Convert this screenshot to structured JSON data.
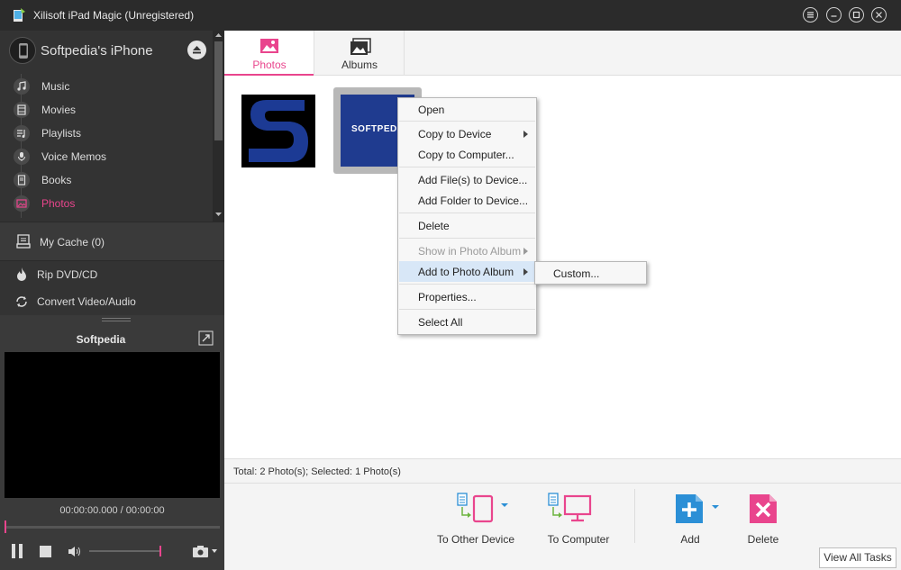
{
  "window": {
    "title": "Xilisoft iPad Magic (Unregistered)"
  },
  "device": {
    "name": "Softpedia's iPhone"
  },
  "nav": {
    "items": [
      {
        "label": "Music",
        "icon": "music-icon"
      },
      {
        "label": "Movies",
        "icon": "film-icon"
      },
      {
        "label": "Playlists",
        "icon": "playlist-icon"
      },
      {
        "label": "Voice Memos",
        "icon": "microphone-icon"
      },
      {
        "label": "Books",
        "icon": "book-icon"
      },
      {
        "label": "Photos",
        "icon": "photo-icon"
      }
    ],
    "active": "Photos",
    "cache_label": "My Cache (0)",
    "rip_label": "Rip DVD/CD",
    "convert_label": "Convert Video/Audio"
  },
  "player": {
    "title": "Softpedia",
    "time": "00:00:00.000 / 00:00:00",
    "progress": 0
  },
  "tabs": [
    {
      "label": "Photos",
      "active": true
    },
    {
      "label": "Albums",
      "active": false
    }
  ],
  "thumbnails": [
    {
      "caption": ""
    },
    {
      "caption": "SOFTPEDIA",
      "selected": true
    }
  ],
  "context_menu": {
    "items": [
      {
        "label": "Open"
      },
      {
        "label": "Copy to Device"
      },
      {
        "label": "Copy to Computer..."
      },
      {
        "label": "Add File(s) to Device..."
      },
      {
        "label": "Add Folder to Device..."
      },
      {
        "label": "Delete"
      },
      {
        "label": "Show in Photo Album"
      },
      {
        "label": "Add to Photo Album"
      },
      {
        "label": "Properties..."
      },
      {
        "label": "Select All"
      }
    ],
    "submenu_item": "Custom..."
  },
  "status": {
    "text": "Total: 2 Photo(s); Selected: 1 Photo(s)"
  },
  "actions": {
    "to_other_device": "To Other Device",
    "to_computer": "To Computer",
    "add": "Add",
    "delete": "Delete",
    "view_all_tasks": "View All Tasks"
  },
  "colors": {
    "accent": "#e9458d",
    "action_blue": "#2b8fd6",
    "sidebar_bg": "#333333"
  }
}
